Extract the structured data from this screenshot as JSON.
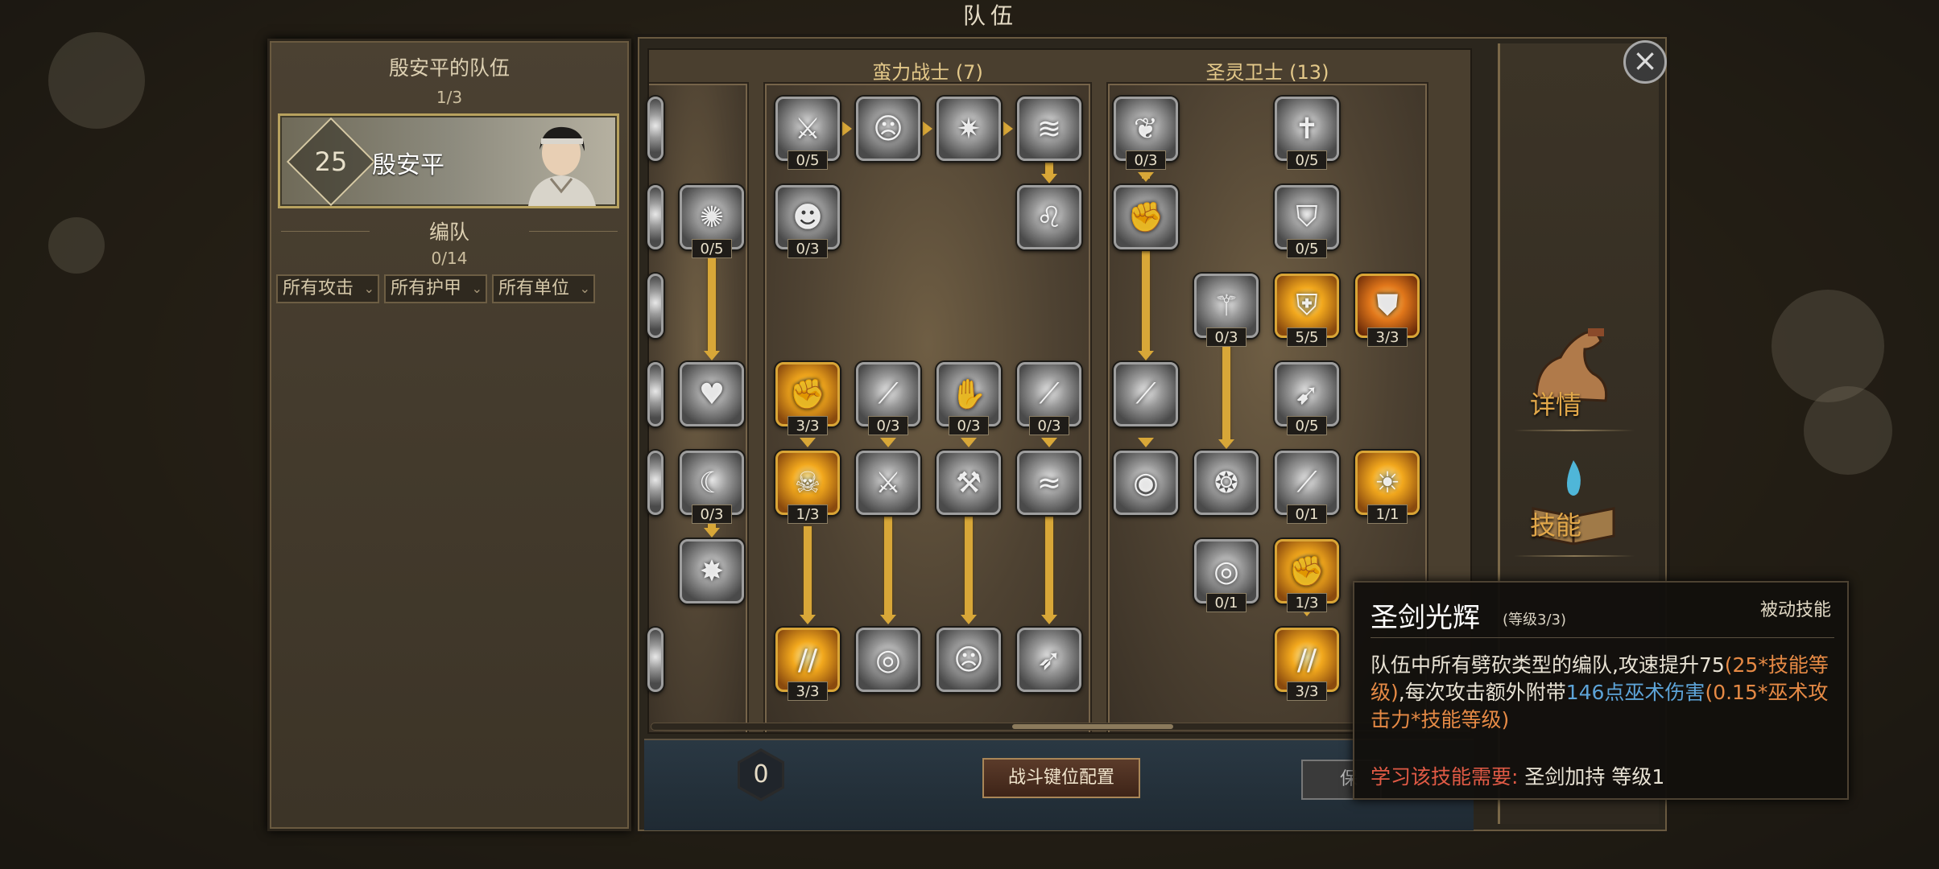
{
  "window_title": "队伍",
  "team_panel": {
    "header": "殷安平的队伍",
    "count": "1/3",
    "leader": {
      "level": "25",
      "name": "殷安平"
    },
    "formation_title": "编队",
    "formation_count": "0/14",
    "filters": [
      "所有攻击",
      "所有护甲",
      "所有单位"
    ]
  },
  "skill_trees": [
    {
      "title": "蛮力战士 (7)",
      "nodes": [
        {
          "id": "b1",
          "level": "0/5",
          "icon": "crossed-axes-icon",
          "gold": false
        },
        {
          "id": "b2",
          "level": "",
          "icon": "roaring-warrior-icon",
          "gold": false
        },
        {
          "id": "b3",
          "level": "",
          "icon": "burst-light-icon",
          "gold": false
        },
        {
          "id": "b4",
          "level": "",
          "icon": "whirlwind-icon",
          "gold": false
        },
        {
          "id": "b5",
          "level": "0/3",
          "icon": "beast-face-icon",
          "gold": false
        },
        {
          "id": "b6",
          "level": "",
          "icon": "lion-head-icon",
          "gold": false
        },
        {
          "id": "b7",
          "level": "3/3",
          "icon": "fire-slash-icon",
          "gold": true
        },
        {
          "id": "b8",
          "level": "0/3",
          "icon": "blade-icon",
          "gold": false
        },
        {
          "id": "b9",
          "level": "0/3",
          "icon": "gauntlet-icon",
          "gold": false
        },
        {
          "id": "b10",
          "level": "0/3",
          "icon": "dagger-strike-icon",
          "gold": false
        },
        {
          "id": "b11",
          "level": "1/3",
          "icon": "flame-skull-icon",
          "gold": true
        },
        {
          "id": "b12",
          "level": "",
          "icon": "sword-thrust-icon",
          "gold": false
        },
        {
          "id": "b13",
          "level": "",
          "icon": "hammer-icon",
          "gold": false
        },
        {
          "id": "b14",
          "level": "",
          "icon": "claw-slash-icon",
          "gold": false
        },
        {
          "id": "b15",
          "level": "3/3",
          "icon": "flame-strike-icon",
          "gold": true
        },
        {
          "id": "b16",
          "level": "",
          "icon": "spin-slash-icon",
          "gold": false
        },
        {
          "id": "b17",
          "level": "",
          "icon": "rage-face-icon",
          "gold": false
        },
        {
          "id": "b18",
          "level": "",
          "icon": "spiral-blade-icon",
          "gold": false
        }
      ]
    },
    {
      "title": "圣灵卫士 (13)",
      "nodes": [
        {
          "id": "h1",
          "level": "0/3",
          "icon": "feather-blade-icon",
          "gold": false
        },
        {
          "id": "h2",
          "level": "0/5",
          "icon": "holy-sword-icon",
          "gold": false
        },
        {
          "id": "h3",
          "level": "",
          "icon": "sword-fist-icon",
          "gold": false
        },
        {
          "id": "h4",
          "level": "0/5",
          "icon": "winged-shield-icon",
          "gold": false
        },
        {
          "id": "h5",
          "level": "0/3",
          "icon": "light-pillar-icon",
          "gold": false
        },
        {
          "id": "h6",
          "level": "5/5",
          "icon": "golden-armor-icon",
          "gold": true
        },
        {
          "id": "h7",
          "level": "3/3",
          "icon": "golden-shield-icon",
          "gold": true
        },
        {
          "id": "h8",
          "level": "",
          "icon": "runed-blade-icon",
          "gold": false
        },
        {
          "id": "h9",
          "level": "0/5",
          "icon": "spear-strike-icon",
          "gold": false
        },
        {
          "id": "h10",
          "level": "",
          "icon": "orb-icon",
          "gold": false
        },
        {
          "id": "h11",
          "level": "",
          "icon": "radiant-burst-icon",
          "gold": false
        },
        {
          "id": "h12",
          "level": "0/1",
          "icon": "sword-slash-icon",
          "gold": false
        },
        {
          "id": "h13",
          "level": "1/1",
          "icon": "sun-burst-icon",
          "gold": true
        },
        {
          "id": "h14",
          "level": "0/1",
          "icon": "vortex-icon",
          "gold": false
        },
        {
          "id": "h15",
          "level": "1/3",
          "icon": "golden-fist-icon",
          "gold": true
        },
        {
          "id": "h16",
          "level": "3/3",
          "icon": "golden-sword-icon",
          "gold": true
        }
      ]
    },
    {
      "title": "",
      "nodes": [
        {
          "id": "p1",
          "level": "0/5",
          "icon": "spark-orb-icon",
          "gold": false
        },
        {
          "id": "p2",
          "level": "",
          "icon": "heart-icon",
          "gold": false
        },
        {
          "id": "p3",
          "level": "0/3",
          "icon": "crescent-slash-icon",
          "gold": false
        },
        {
          "id": "p4",
          "level": "",
          "icon": "impact-burst-icon",
          "gold": false
        }
      ]
    }
  ],
  "bottom_bar": {
    "skill_points": "0",
    "keybind_button": "战斗键位配置",
    "secondary_button": "保"
  },
  "side_tabs": [
    {
      "label": "详情",
      "icon": "flexed-arm-icon"
    },
    {
      "label": "技能",
      "icon": "spellbook-icon"
    }
  ],
  "tooltip": {
    "name": "圣剑光辉",
    "level": "(等级3/3)",
    "type": "被动技能",
    "desc_1": "队伍中所有劈砍类型的编队,攻速提升75",
    "desc_2": "(25*技能等级)",
    "desc_3": ",每次攻击额外附带",
    "desc_4": "146点巫术伤害",
    "desc_5": "(0.15*巫术攻击力*技能等级)",
    "req_label": "学习该技能需要:",
    "req_value": "圣剑加持 等级1"
  },
  "colors": {
    "gold_accent": "#d8a738",
    "tree_title": "#e4c98a",
    "tooltip_orange": "#e68a45",
    "tooltip_blue": "#5da4d8",
    "tooltip_requirement": "#e05a45"
  }
}
